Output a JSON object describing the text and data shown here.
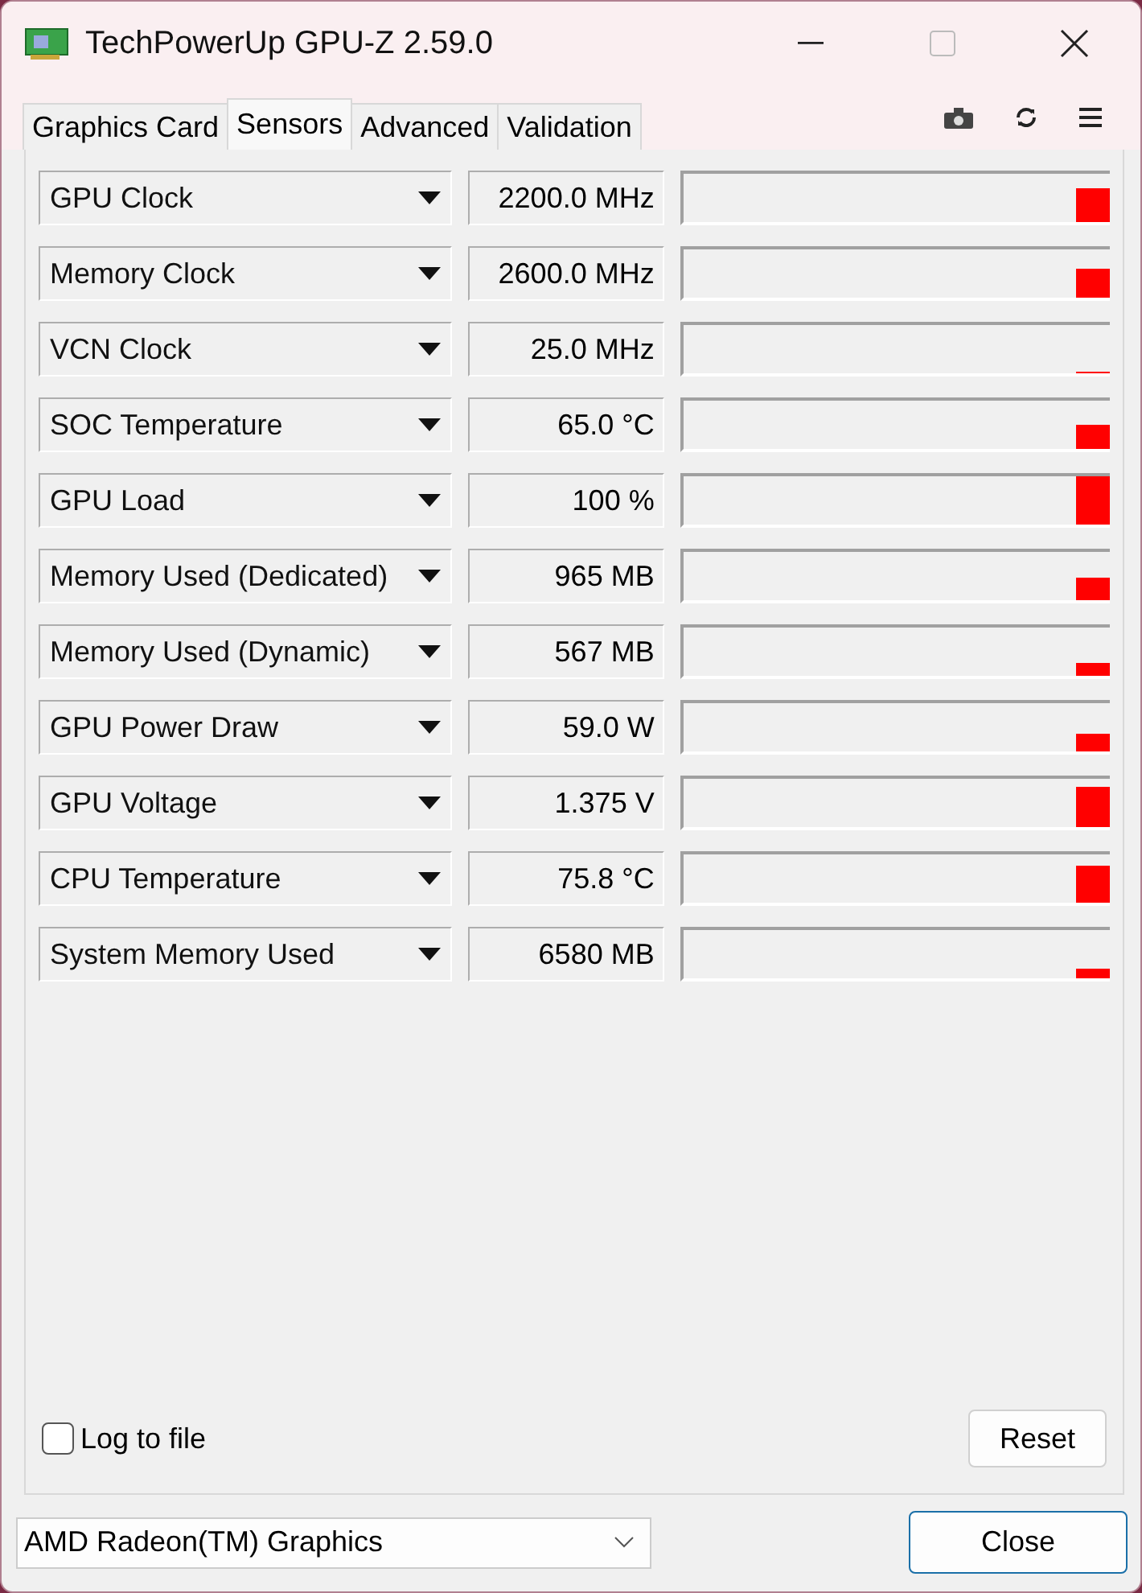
{
  "window": {
    "title": "TechPowerUp GPU-Z 2.59.0"
  },
  "tabs": [
    {
      "label": "Graphics Card",
      "selected": false
    },
    {
      "label": "Sensors",
      "selected": true
    },
    {
      "label": "Advanced",
      "selected": false
    },
    {
      "label": "Validation",
      "selected": false
    }
  ],
  "sensors": [
    {
      "name": "GPU Clock",
      "value": "2200.0 MHz"
    },
    {
      "name": "Memory Clock",
      "value": "2600.0 MHz"
    },
    {
      "name": "VCN Clock",
      "value": "25.0 MHz"
    },
    {
      "name": "SOC Temperature",
      "value": "65.0 °C"
    },
    {
      "name": "GPU Load",
      "value": "100 %"
    },
    {
      "name": "Memory Used (Dedicated)",
      "value": "965 MB"
    },
    {
      "name": "Memory Used (Dynamic)",
      "value": "567 MB"
    },
    {
      "name": "GPU Power Draw",
      "value": "59.0 W"
    },
    {
      "name": "GPU Voltage",
      "value": "1.375 V"
    },
    {
      "name": "CPU Temperature",
      "value": "75.8 °C"
    },
    {
      "name": "System Memory Used",
      "value": "6580 MB"
    }
  ],
  "log_to_file": {
    "label": "Log to file",
    "checked": false
  },
  "reset_button": "Reset",
  "device_select": {
    "value": "AMD Radeon(TM) Graphics"
  },
  "close_button": "Close"
}
